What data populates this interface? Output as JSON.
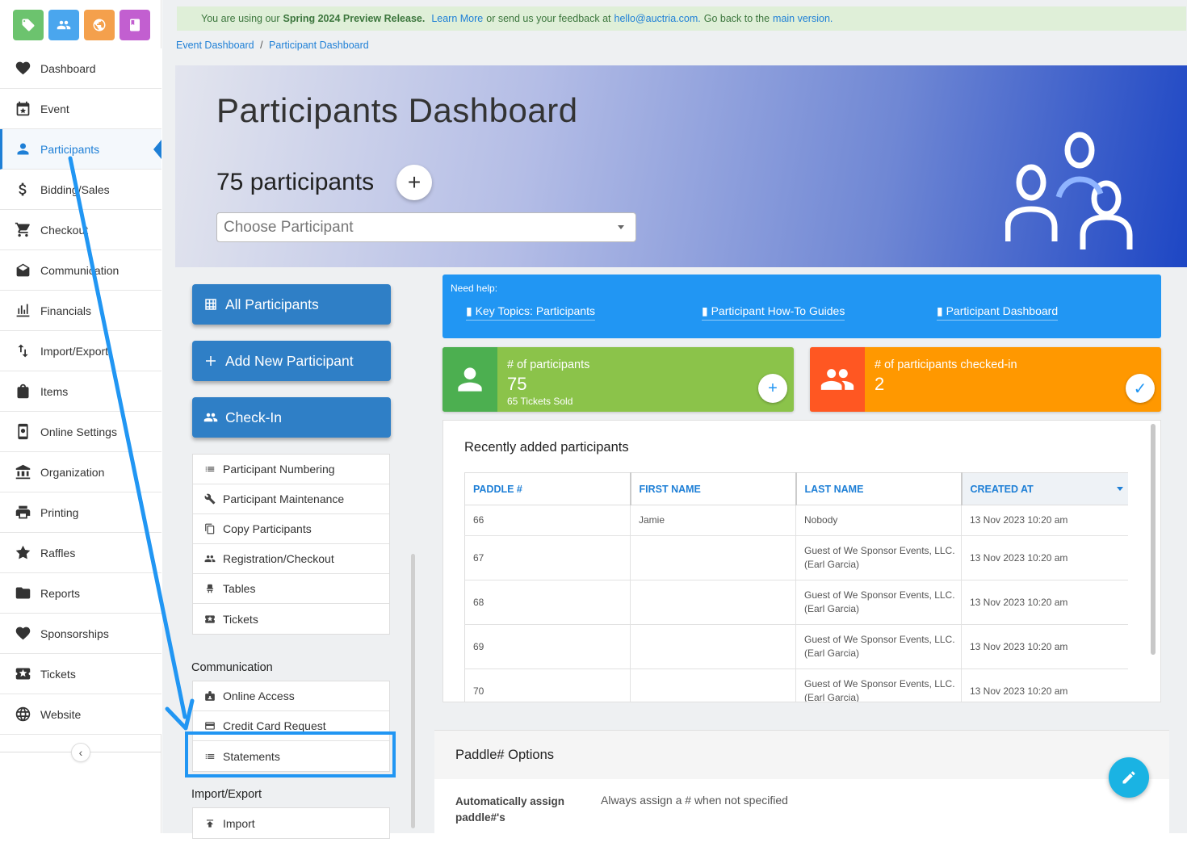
{
  "sidebar": {
    "tiles": [
      {
        "icon": "tag-icon",
        "color": "#6cc36e"
      },
      {
        "icon": "people-icon",
        "color": "#4aa6ee"
      },
      {
        "icon": "globe-icon",
        "color": "#f4a04c"
      },
      {
        "icon": "book-icon",
        "color": "#c25fd0"
      }
    ],
    "items": [
      {
        "label": "Dashboard",
        "icon": "heart-hand-icon"
      },
      {
        "label": "Event",
        "icon": "calendar-star-icon"
      },
      {
        "label": "Participants",
        "icon": "person-icon",
        "active": true
      },
      {
        "label": "Bidding/Sales",
        "icon": "dollar-icon"
      },
      {
        "label": "Checkout",
        "icon": "cart-icon"
      },
      {
        "label": "Communication",
        "icon": "envelope-icon"
      },
      {
        "label": "Financials",
        "icon": "chart-icon"
      },
      {
        "label": "Import/Export",
        "icon": "import-export-icon"
      },
      {
        "label": "Items",
        "icon": "bag-icon"
      },
      {
        "label": "Online Settings",
        "icon": "phone-settings-icon"
      },
      {
        "label": "Organization",
        "icon": "building-icon"
      },
      {
        "label": "Printing",
        "icon": "printer-icon"
      },
      {
        "label": "Raffles",
        "icon": "raffle-icon"
      },
      {
        "label": "Reports",
        "icon": "folder-icon"
      },
      {
        "label": "Sponsorships",
        "icon": "handshake-icon"
      },
      {
        "label": "Tickets",
        "icon": "ticket-icon"
      },
      {
        "label": "Website",
        "icon": "globe-icon"
      }
    ],
    "collapse_icon": "‹"
  },
  "banner": {
    "pre": "You are using our",
    "release": "Spring 2024 Preview Release.",
    "learn": "Learn More",
    "mid": "or send us your feedback at",
    "email": "hello@auctria.com.",
    "back": "Go back to the",
    "main_link": "main version."
  },
  "breadcrumb": {
    "items": [
      "Event Dashboard",
      "Participant Dashboard"
    ],
    "sep": "/"
  },
  "hero": {
    "title": "Participants Dashboard",
    "count": "75 participants",
    "add": "+",
    "select_placeholder": "Choose Participant"
  },
  "left": {
    "buttons": {
      "all": "All Participants",
      "add": "Add New Participant",
      "checkin": "Check-In"
    },
    "menu1": [
      {
        "label": "Participant Numbering",
        "icon": "list-icon"
      },
      {
        "label": "Participant Maintenance",
        "icon": "wrench-icon"
      },
      {
        "label": "Copy Participants",
        "icon": "copy-icon"
      },
      {
        "label": "Registration/Checkout",
        "icon": "people-icon"
      },
      {
        "label": "Tables",
        "icon": "chair-icon"
      },
      {
        "label": "Tickets",
        "icon": "ticket-icon"
      }
    ],
    "communication_heading": "Communication",
    "menu2": [
      {
        "label": "Online Access",
        "icon": "badge-icon"
      },
      {
        "label": "Credit Card Request",
        "icon": "credit-card-icon"
      },
      {
        "label": "Statements",
        "icon": "list-icon"
      }
    ],
    "import_heading": "Import/Export",
    "menu3": [
      {
        "label": "Import",
        "icon": "upload-icon"
      }
    ]
  },
  "help": {
    "label": "Need help:",
    "links": [
      "Key Topics: Participants",
      "Participant How-To Guides",
      "Participant Dashboard"
    ]
  },
  "stats": {
    "participants": {
      "title": "# of participants",
      "value": "75",
      "sub": "65 Tickets Sold",
      "action": "+",
      "color": "#8bc34a",
      "icon_bg": "#4caf50"
    },
    "checked": {
      "title": "# of participants checked-in",
      "value": "2",
      "action": "✓",
      "color": "#ff9800",
      "icon_bg": "#ff5722"
    }
  },
  "recent": {
    "title": "Recently added participants",
    "columns": [
      "PADDLE #",
      "FIRST NAME",
      "LAST NAME",
      "CREATED AT"
    ],
    "rows": [
      {
        "paddle": "66",
        "first": "Jamie",
        "last": "Nobody",
        "created": "13 Nov 2023 10:20 am"
      },
      {
        "paddle": "67",
        "first": "",
        "last": "Guest of We Sponsor Events, LLC. (Earl Garcia)",
        "created": "13 Nov 2023 10:20 am"
      },
      {
        "paddle": "68",
        "first": "",
        "last": "Guest of We Sponsor Events, LLC. (Earl Garcia)",
        "created": "13 Nov 2023 10:20 am"
      },
      {
        "paddle": "69",
        "first": "",
        "last": "Guest of We Sponsor Events, LLC. (Earl Garcia)",
        "created": "13 Nov 2023 10:20 am"
      },
      {
        "paddle": "70",
        "first": "",
        "last": "Guest of We Sponsor Events, LLC. (Earl Garcia)",
        "created": "13 Nov 2023 10:20 am"
      }
    ]
  },
  "paddle": {
    "title": "Paddle# Options",
    "key": "Automatically assign paddle#'s",
    "value": "Always assign a # when not specified",
    "edit_icon": "pencil-icon"
  },
  "annotation": {
    "arrow_color": "#2196f3",
    "highlight_color": "#2196f3"
  }
}
